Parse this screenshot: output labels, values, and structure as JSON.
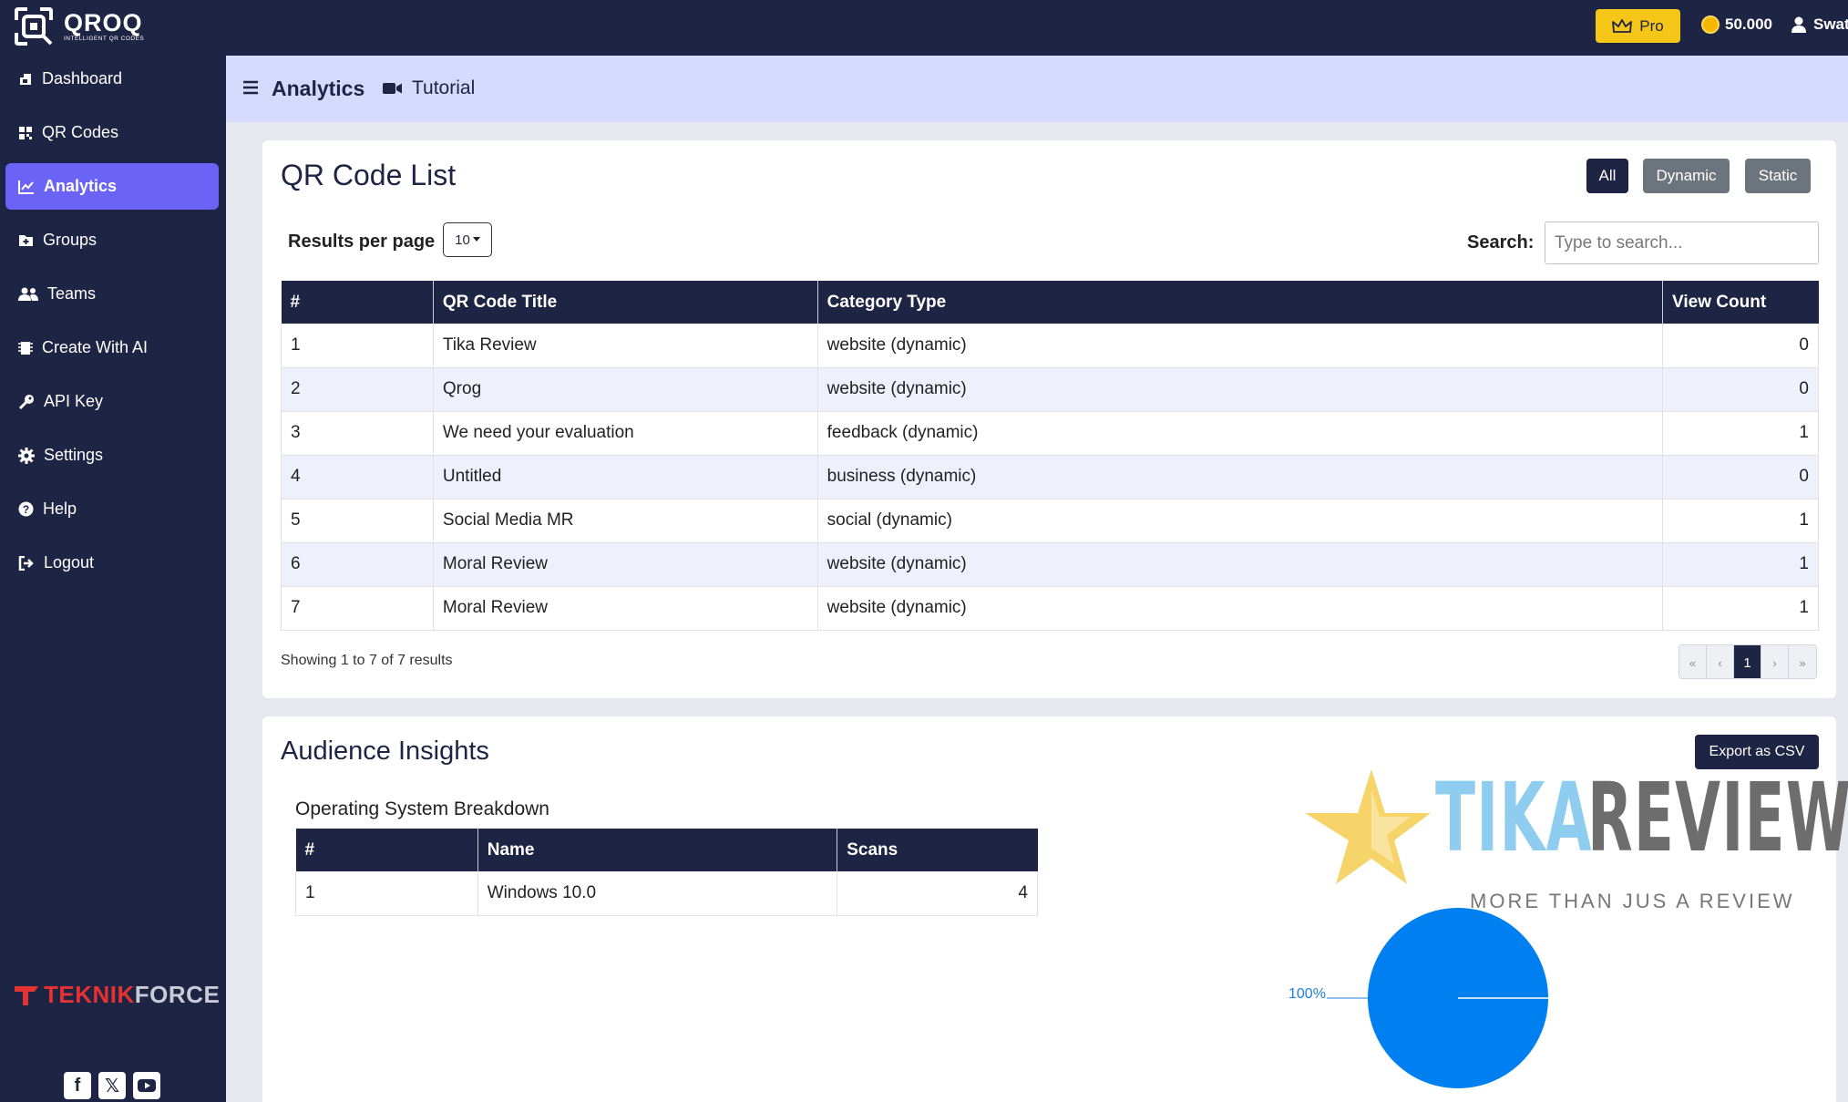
{
  "brand": {
    "name": "QROQ",
    "tagline": "INTELLIGENT QR CODES"
  },
  "topbar": {
    "pro_label": "Pro",
    "credits": "50.000",
    "user_name": "Swat"
  },
  "sidebar": {
    "items": [
      {
        "label": "Dashboard",
        "icon": "dashboard-icon"
      },
      {
        "label": "QR Codes",
        "icon": "qr-codes-icon"
      },
      {
        "label": "Analytics",
        "icon": "chart-line-icon",
        "active": true
      },
      {
        "label": "Groups",
        "icon": "folder-plus-icon"
      },
      {
        "label": "Teams",
        "icon": "users-icon"
      },
      {
        "label": "Create With AI",
        "icon": "chip-icon"
      },
      {
        "label": "API Key",
        "icon": "key-icon"
      },
      {
        "label": "Settings",
        "icon": "gear-icon"
      },
      {
        "label": "Help",
        "icon": "question-circle-icon"
      },
      {
        "label": "Logout",
        "icon": "logout-icon"
      }
    ],
    "footer_brand_1": "TEKNIK",
    "footer_brand_2": "FORCE"
  },
  "header": {
    "title": "Analytics",
    "tutorial_label": "Tutorial"
  },
  "qr_list": {
    "title": "QR Code List",
    "filters": [
      "All",
      "Dynamic",
      "Static"
    ],
    "results_per_page_label": "Results per page",
    "results_per_page_value": "10",
    "search_label": "Search:",
    "search_placeholder": "Type to search...",
    "columns": [
      "#",
      "QR Code Title",
      "Category Type",
      "View Count"
    ],
    "rows": [
      {
        "n": "1",
        "title": "Tika Review",
        "category": "website (dynamic)",
        "views": "0"
      },
      {
        "n": "2",
        "title": "Qrog",
        "category": "website (dynamic)",
        "views": "0"
      },
      {
        "n": "3",
        "title": "We need your evaluation",
        "category": "feedback (dynamic)",
        "views": "1"
      },
      {
        "n": "4",
        "title": "Untitled",
        "category": "business (dynamic)",
        "views": "0"
      },
      {
        "n": "5",
        "title": "Social Media MR",
        "category": "social (dynamic)",
        "views": "1"
      },
      {
        "n": "6",
        "title": "Moral Review",
        "category": "website (dynamic)",
        "views": "1"
      },
      {
        "n": "7",
        "title": "Moral Review",
        "category": "website (dynamic)",
        "views": "1"
      }
    ],
    "showing_text": "Showing 1 to 7 of 7 results",
    "pagination": {
      "first": "«",
      "prev": "‹",
      "current": "1",
      "next": "›",
      "last": "»"
    }
  },
  "audience": {
    "title": "Audience Insights",
    "export_label": "Export as CSV",
    "os_title": "Operating System Breakdown",
    "os_columns": [
      "#",
      "Name",
      "Scans"
    ],
    "os_rows": [
      {
        "n": "1",
        "name": "Windows 10.0",
        "scans": "4"
      }
    ]
  },
  "watermark": {
    "word1": "TIKA",
    "word2": "REVIEW",
    "sub": "MORE THAN JUS A REVIEW"
  },
  "chart_data": {
    "type": "pie",
    "slices": [
      {
        "name": "Windows 10.0",
        "value": 4,
        "label": "100%"
      }
    ],
    "colors": [
      "#0080f0"
    ]
  },
  "colors": {
    "navy": "#1d2444",
    "accent": "#6a63f6",
    "pro": "#f5c518",
    "header_bg": "#d6dafc"
  }
}
